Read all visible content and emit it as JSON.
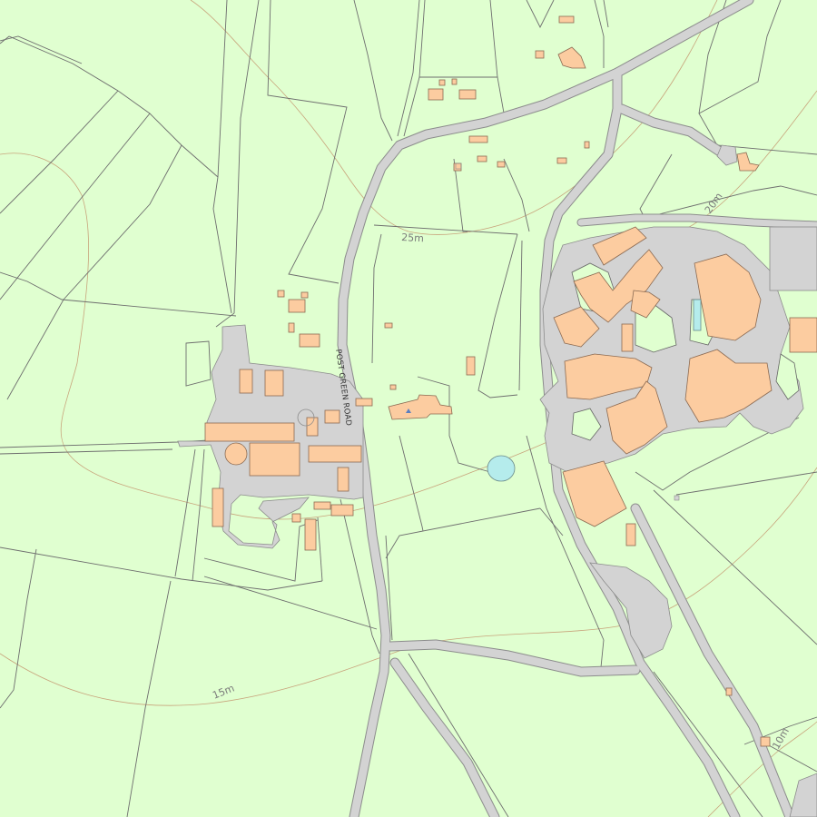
{
  "map": {
    "contour_labels": [
      "25m",
      "20m",
      "15m",
      "10m"
    ],
    "road_labels": [
      "POST GREEN ROAD"
    ]
  },
  "colors": {
    "land": "#e0ffd0",
    "road": "#d3d3d3",
    "building": "#fccca0",
    "water": "#b5ecec",
    "contour": "#c8a47c",
    "boundary": "#666666"
  }
}
